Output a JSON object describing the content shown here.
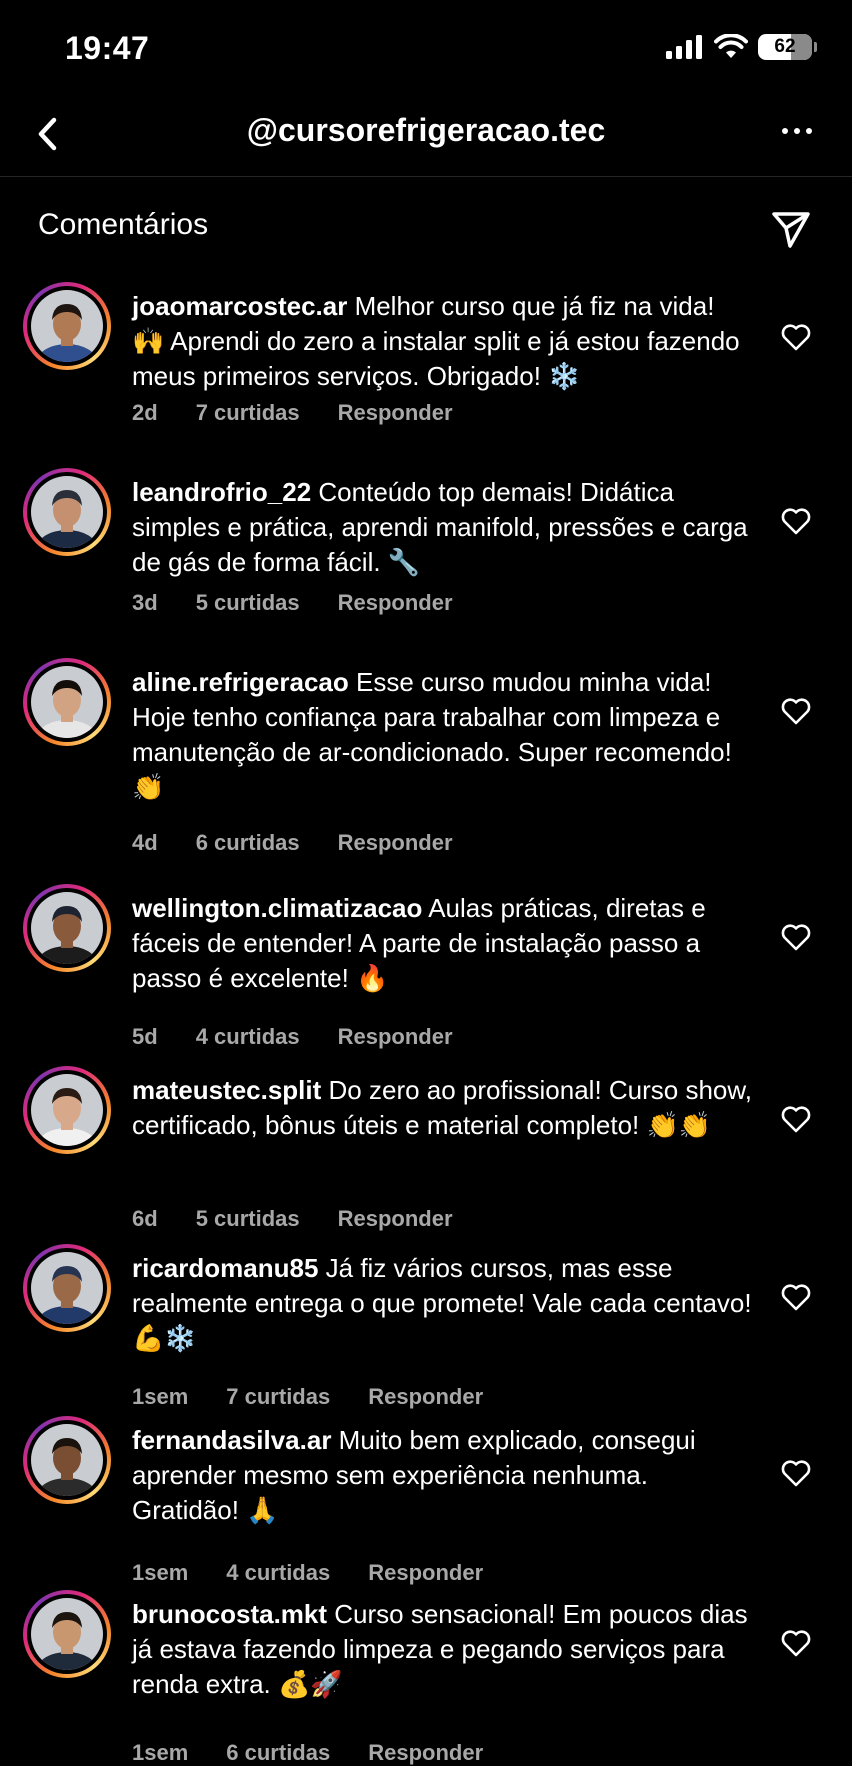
{
  "status_bar": {
    "time": "19:47",
    "battery": "62"
  },
  "header": {
    "title": "@cursorefrigeracao.tec"
  },
  "section": {
    "title": "Comentários"
  },
  "comments": [
    {
      "user": "joaomarcostec.ar",
      "text": "Melhor curso que já fiz na vida! 🙌 Aprendi do zero a instalar split e já estou fazendo meus primeiros serviços. Obrigado! ❄️",
      "time": "2d",
      "likes": "7 curtidas",
      "reply": "Responder",
      "skin": "#b07a55",
      "hair": "#1e1510",
      "shirt": "#2f4f8f"
    },
    {
      "user": "leandrofrio_22",
      "text": "Conteúdo top demais! Didática simples e prática, aprendi manifold, pressões e carga de gás de forma fácil. 🔧",
      "time": "3d",
      "likes": "5 curtidas",
      "reply": "Responder",
      "skin": "#c49070",
      "hair": "#2a2f3a",
      "shirt": "#1d2a44"
    },
    {
      "user": "aline.refrigeracao",
      "text": "Esse curso mudou minha vida! Hoje tenho confiança para trabalhar com limpeza e manutenção de ar-condicionado. Super recomendo! 👏",
      "time": "4d",
      "likes": "6 curtidas",
      "reply": "Responder",
      "skin": "#d2a383",
      "hair": "#140e0a",
      "shirt": "#e6e6e6"
    },
    {
      "user": "wellington.climatizacao",
      "text": "Aulas práticas, diretas e fáceis de entender! A parte de instalação passo a passo é excelente! 🔥",
      "time": "5d",
      "likes": "4 curtidas",
      "reply": "Responder",
      "skin": "#8a5a3c",
      "hair": "#1d2330",
      "shirt": "#1c1c1c"
    },
    {
      "user": "mateustec.split",
      "text": "Do zero ao profissional! Curso show, certificado, bônus úteis e material completo! 👏👏",
      "time": "6d",
      "likes": "5 curtidas",
      "reply": "Responder",
      "skin": "#d8a88a",
      "hair": "#2a1c14",
      "shirt": "#f0f0f0"
    },
    {
      "user": "ricardomanu85",
      "text": "Já fiz vários cursos, mas esse realmente entrega o que promete! Vale cada centavo! 💪❄️",
      "time": "1sem",
      "likes": "7 curtidas",
      "reply": "Responder",
      "skin": "#9a6a48",
      "hair": "#263452",
      "shirt": "#223a6a"
    },
    {
      "user": "fernandasilva.ar",
      "text": "Muito bem explicado, consegui aprender mesmo sem experiência nenhuma. Gratidão! 🙏",
      "time": "1sem",
      "likes": "4 curtidas",
      "reply": "Responder",
      "skin": "#7a4e32",
      "hair": "#1a120d",
      "shirt": "#2b2b2b"
    },
    {
      "user": "brunocosta.mkt",
      "text": "Curso sensacional! Em poucos dias já estava fazendo limpeza e pegando serviços para renda extra. 💰🚀",
      "time": "1sem",
      "likes": "6 curtidas",
      "reply": "Responder",
      "skin": "#c8966f",
      "hair": "#1c140e",
      "shirt": "#1f2a3a"
    }
  ]
}
